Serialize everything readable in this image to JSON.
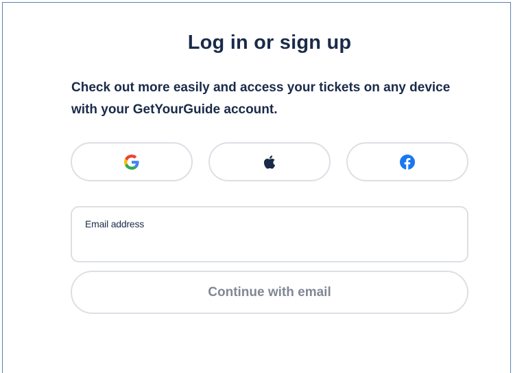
{
  "dialog": {
    "title": "Log in or sign up",
    "subtitle": "Check out more easily and access your tickets on any device with your GetYourGuide account."
  },
  "social": {
    "buttons": [
      {
        "provider": "Google",
        "icon": "google-icon"
      },
      {
        "provider": "Apple",
        "icon": "apple-icon"
      },
      {
        "provider": "Facebook",
        "icon": "facebook-icon"
      }
    ]
  },
  "email": {
    "label": "Email address",
    "value": "",
    "placeholder": ""
  },
  "continue": {
    "label": "Continue with email"
  },
  "colors": {
    "text": "#1a2b49",
    "border": "#dcdfe4",
    "disabled_text": "#808896",
    "facebook": "#1877f2",
    "frame": "#5a7fb4"
  }
}
